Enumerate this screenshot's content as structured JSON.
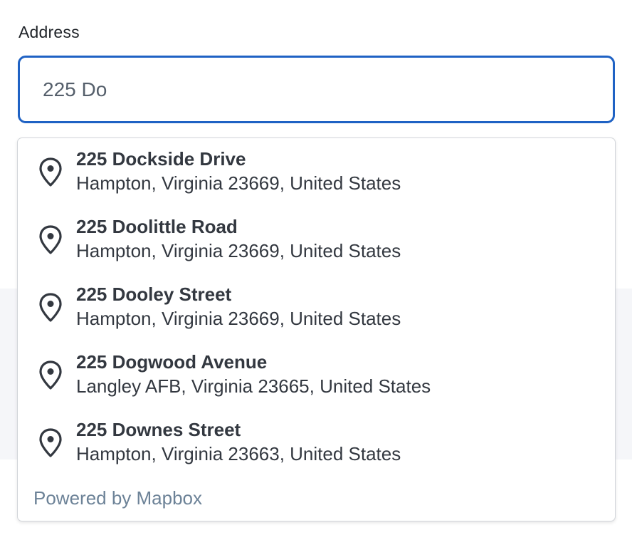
{
  "form": {
    "address_label": "Address",
    "address_value": "225 Do"
  },
  "suggestions": [
    {
      "name": "225 Dockside Drive",
      "place": "Hampton, Virginia 23669, United States",
      "icon": "map-pin-icon"
    },
    {
      "name": "225 Doolittle Road",
      "place": "Hampton, Virginia 23669, United States",
      "icon": "map-pin-icon"
    },
    {
      "name": "225 Dooley Street",
      "place": "Hampton, Virginia 23669, United States",
      "icon": "map-pin-icon"
    },
    {
      "name": "225 Dogwood Avenue",
      "place": "Langley AFB, Virginia 23665, United States",
      "icon": "map-pin-icon"
    },
    {
      "name": "225 Downes Street",
      "place": "Hampton, Virginia 23663, United States",
      "icon": "map-pin-icon"
    }
  ],
  "attribution": "Powered by Mapbox",
  "colors": {
    "input_border": "#1f62c4",
    "attribution_text": "#6c8297",
    "suggestion_text": "#333840"
  }
}
